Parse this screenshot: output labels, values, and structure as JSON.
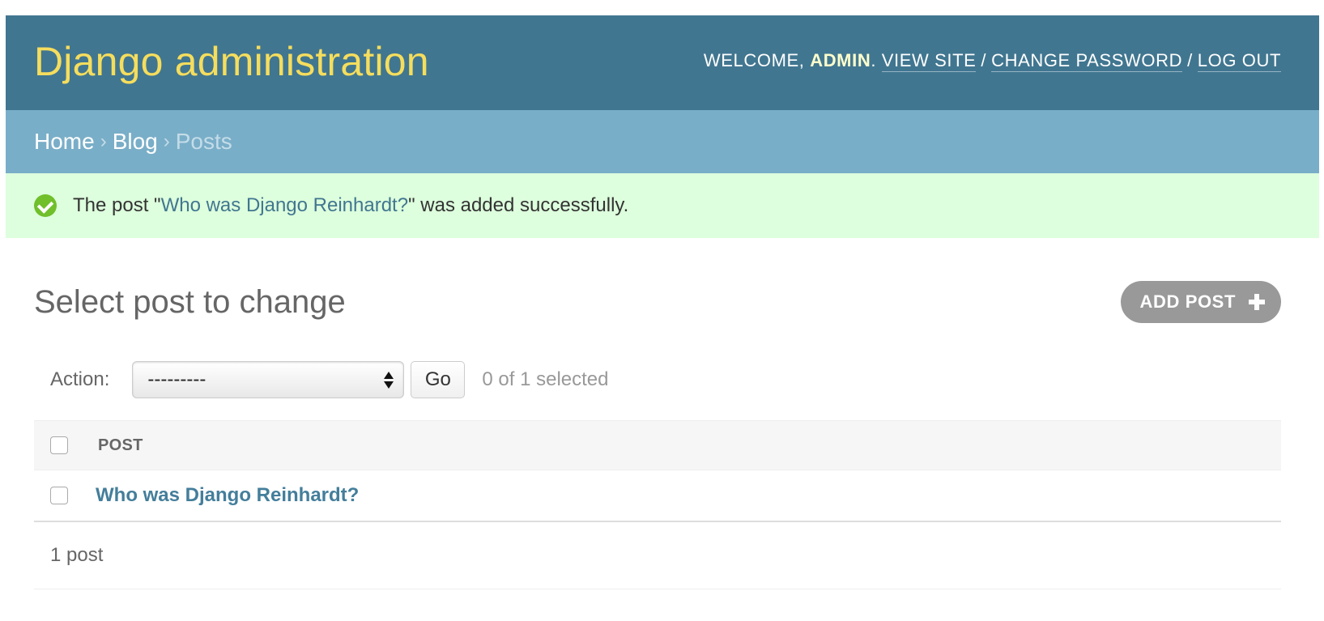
{
  "header": {
    "site_title": "Django administration",
    "welcome_prefix": "Welcome, ",
    "username": "admin",
    "after_username": ".",
    "view_site": "View site",
    "change_password": "Change password",
    "log_out": "Log out",
    "separator": "/"
  },
  "breadcrumbs": {
    "home": "Home",
    "app": "Blog",
    "current": "Posts",
    "arrow": "›"
  },
  "message": {
    "prefix": "The post \"",
    "link": "Who was Django Reinhardt?",
    "suffix": "\" was added successfully."
  },
  "content": {
    "title": "Select post to change",
    "add_button": "Add post"
  },
  "actions": {
    "label": "Action:",
    "selected_option": "---------",
    "go": "Go",
    "counter": "0 of 1 selected"
  },
  "table": {
    "header": "Post",
    "rows": [
      {
        "title": "Who was Django Reinhardt?"
      }
    ]
  },
  "paginator": {
    "text": "1 post"
  },
  "colors": {
    "header_bg": "#417690",
    "title_color": "#f5dd5d",
    "breadcrumb_bg": "#79aec8",
    "success_bg": "#ddffdd",
    "success_icon": "#70bf2b",
    "link": "#447e9b"
  }
}
